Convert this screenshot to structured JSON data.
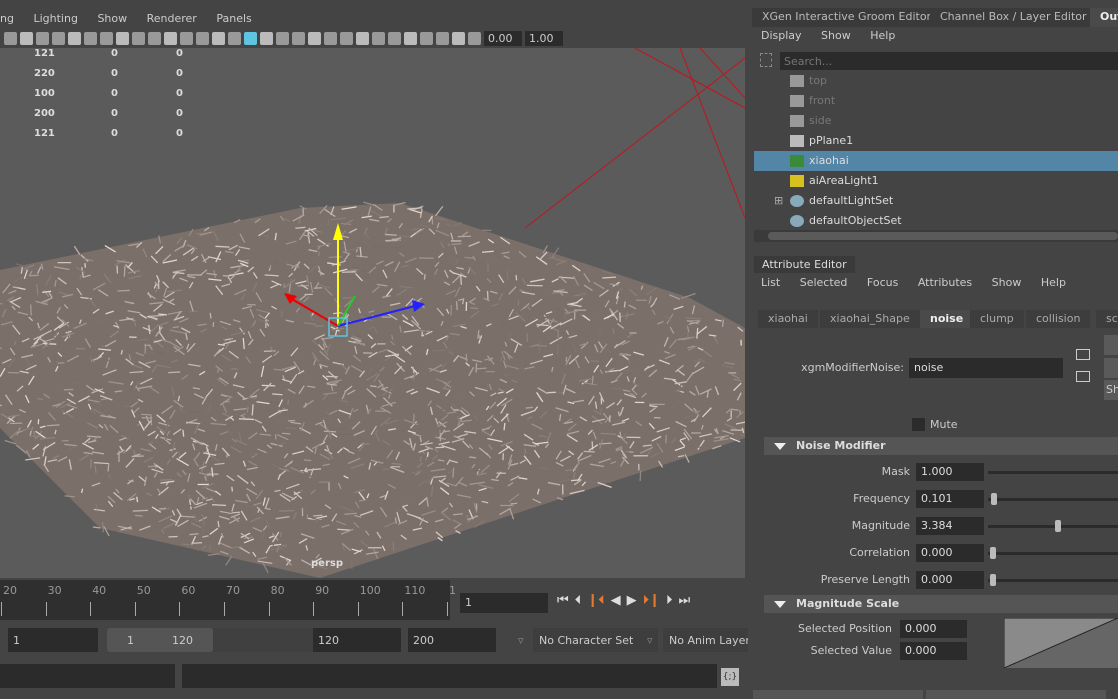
{
  "viewport": {
    "menu": [
      "ng",
      "Lighting",
      "Show",
      "Renderer",
      "Panels"
    ],
    "exposure": "0.00",
    "gamma": "1.00",
    "hud_rows": [
      [
        "121",
        "0",
        "0"
      ],
      [
        "220",
        "0",
        "0"
      ],
      [
        "100",
        "0",
        "0"
      ],
      [
        "200",
        "0",
        "0"
      ],
      [
        "121",
        "0",
        "0"
      ]
    ],
    "camera_label": "persp"
  },
  "right_tabs": [
    "XGen Interactive Groom Editor",
    "Channel Box / Layer Editor",
    "Out"
  ],
  "outliner": {
    "menu": [
      "Display",
      "Show",
      "Help"
    ],
    "search_placeholder": "Search...",
    "items": [
      {
        "label": "top",
        "icon": "camera-icon",
        "dim": true
      },
      {
        "label": "front",
        "icon": "camera-icon",
        "dim": true
      },
      {
        "label": "side",
        "icon": "camera-icon",
        "dim": true
      },
      {
        "label": "pPlane1",
        "icon": "mesh-icon"
      },
      {
        "label": "xiaohai",
        "icon": "xgen-description-icon",
        "selected": true
      },
      {
        "label": "aiAreaLight1",
        "icon": "area-light-icon"
      },
      {
        "label": "defaultLightSet",
        "icon": "set-icon",
        "expandable": true
      },
      {
        "label": "defaultObjectSet",
        "icon": "set-icon"
      }
    ]
  },
  "attribute_editor": {
    "title": "Attribute Editor",
    "menu": [
      "List",
      "Selected",
      "Focus",
      "Attributes",
      "Show",
      "Help"
    ],
    "tabs": [
      "xiaohai",
      "xiaohai_Shape",
      "noise",
      "clump",
      "collision",
      "scu"
    ],
    "active_tab": "noise",
    "node_label": "xgmModifierNoise:",
    "node_value": "noise",
    "side_button": "Sh",
    "mute_label": "Mute",
    "section1": "Noise Modifier",
    "attrs": [
      {
        "label": "Mask",
        "value": "1.000",
        "slider": 1.0
      },
      {
        "label": "Frequency",
        "value": "0.101",
        "slider": 0.01
      },
      {
        "label": "Magnitude",
        "value": "3.384",
        "slider": 0.5
      },
      {
        "label": "Correlation",
        "value": "0.000",
        "slider": 0.0
      },
      {
        "label": "Preserve Length",
        "value": "0.000",
        "slider": 0.0
      }
    ],
    "section2": "Magnitude Scale",
    "selected_position_label": "Selected Position",
    "selected_position": "0.000",
    "selected_value_label": "Selected Value",
    "selected_value": "0.000"
  },
  "timeline": {
    "ticks": [
      "20",
      "30",
      "40",
      "50",
      "60",
      "70",
      "80",
      "90",
      "100",
      "110",
      "1"
    ],
    "current_frame": "1",
    "start": "1",
    "range_start": "1",
    "range_end": "120",
    "end": "120",
    "anim_end": "200",
    "character_set": "No Character Set",
    "anim_layer": "No Anim Layer"
  },
  "colors": {
    "selection": "#5285a6",
    "accent": "#5ec4e0"
  }
}
